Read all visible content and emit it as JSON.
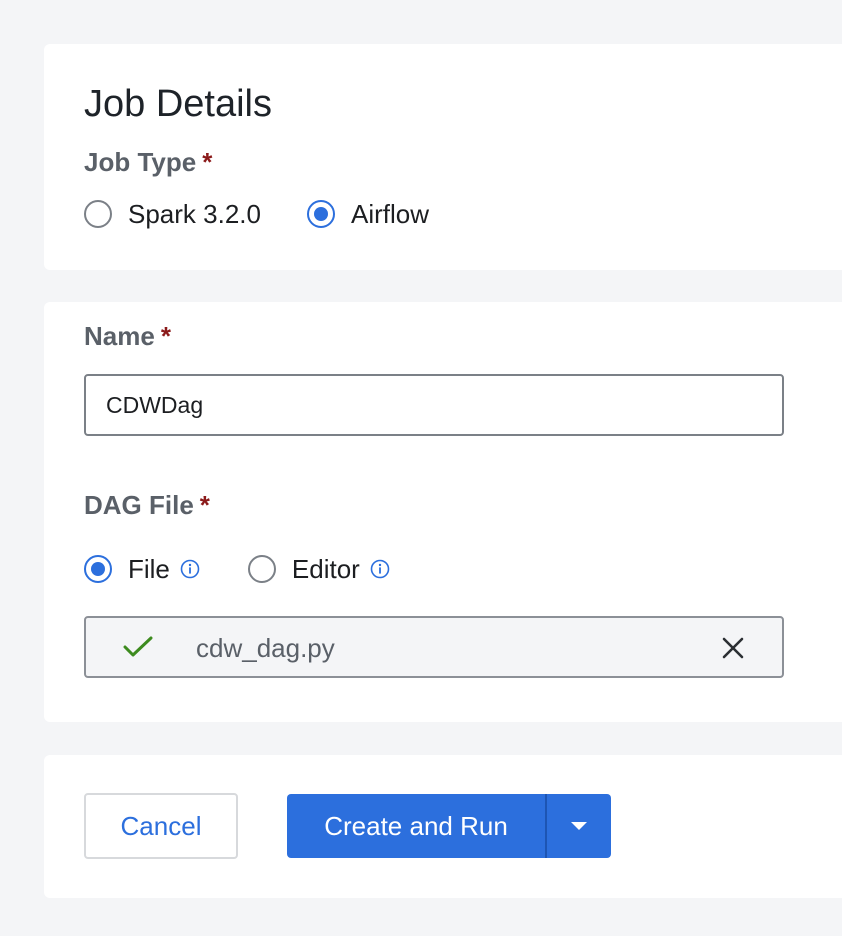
{
  "job_details": {
    "title": "Job Details",
    "job_type": {
      "label": "Job Type",
      "required_mark": "*",
      "options": [
        {
          "label": "Spark 3.2.0",
          "selected": false
        },
        {
          "label": "Airflow",
          "selected": true
        }
      ]
    }
  },
  "form": {
    "name": {
      "label": "Name",
      "required_mark": "*",
      "value": "CDWDag"
    },
    "dag_file": {
      "label": "DAG File",
      "required_mark": "*",
      "options": [
        {
          "label": "File",
          "selected": true,
          "icon": "info-icon"
        },
        {
          "label": "Editor",
          "selected": false,
          "icon": "info-icon"
        }
      ],
      "uploaded_file": {
        "name": "cdw_dag.py",
        "status_icon": "check-icon",
        "remove_icon": "close-icon"
      }
    }
  },
  "actions": {
    "cancel_label": "Cancel",
    "primary_label": "Create and Run",
    "split_icon": "caret-down-icon"
  },
  "colors": {
    "accent": "#2c6fdd",
    "required": "#8b1a1a",
    "success": "#3d8b1f",
    "background": "#f4f5f7"
  }
}
